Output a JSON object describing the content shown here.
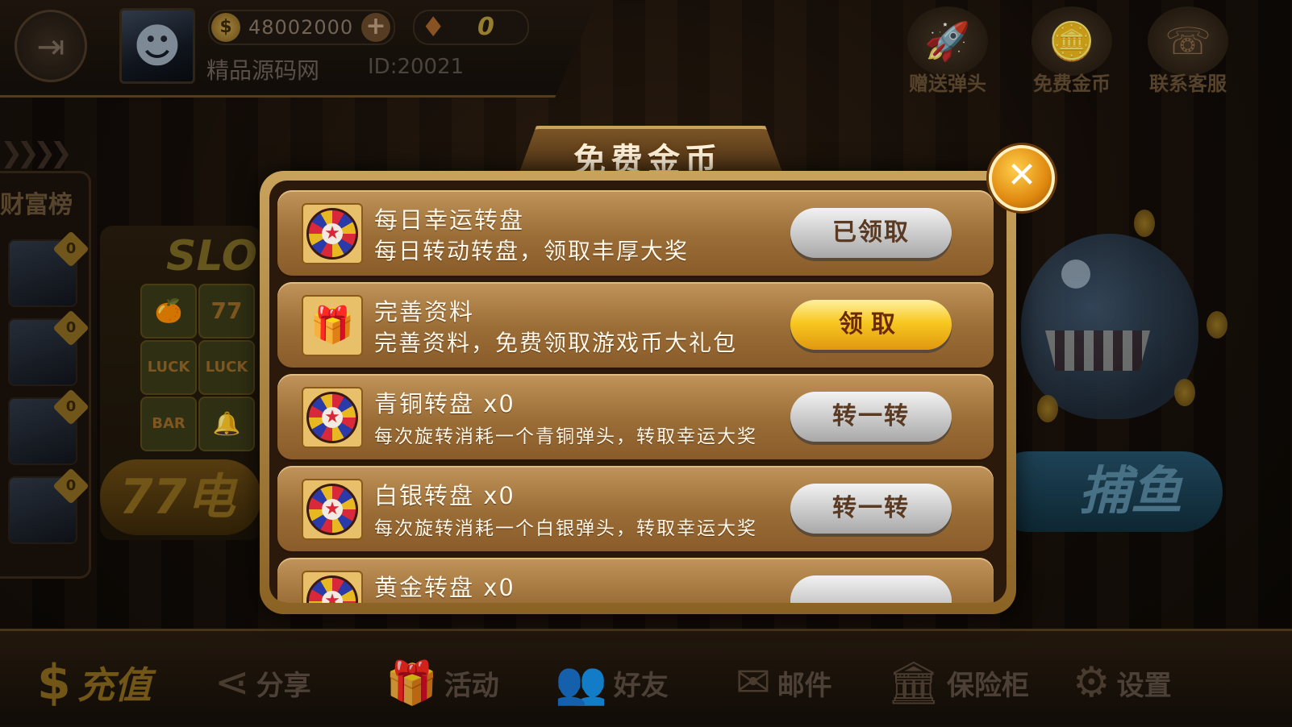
{
  "header": {
    "coins": "48002000",
    "gems": "0",
    "nickname": "精品源码网",
    "user_id": "ID:20021",
    "exit_icon": "exit-door-icon",
    "plus_icon": "plus-icon"
  },
  "top_actions": [
    {
      "label": "赠送弹头",
      "icon": "missile-icon",
      "glyph": "🚀"
    },
    {
      "label": "免费金币",
      "icon": "gold-coins-icon",
      "glyph": "🪙"
    },
    {
      "label": "联系客服",
      "icon": "phone-icon",
      "glyph": "☏"
    }
  ],
  "rank": {
    "title": "财富榜",
    "badge": "0"
  },
  "games": {
    "slot_title": "SLO",
    "slot_name": "77电",
    "slot_cells": [
      "🍊",
      "77",
      "LUCK",
      "LUCK",
      "BAR",
      "🔔"
    ],
    "fish_name": "捕鱼"
  },
  "bottom_nav": [
    {
      "label": "充值",
      "icon": "money-bag-icon",
      "glyph": "$"
    },
    {
      "label": "分享",
      "icon": "share-icon",
      "glyph": "⋖"
    },
    {
      "label": "活动",
      "icon": "gift-icon",
      "glyph": "🎁"
    },
    {
      "label": "好友",
      "icon": "friends-icon",
      "glyph": "👥"
    },
    {
      "label": "邮件",
      "icon": "mailbox-icon",
      "glyph": "✉"
    },
    {
      "label": "保险柜",
      "icon": "bank-icon",
      "glyph": "🏛"
    },
    {
      "label": "设置",
      "icon": "gear-icon",
      "glyph": "⚙"
    }
  ],
  "dialog": {
    "title": "免费金币",
    "close_icon": "close-icon",
    "rows": [
      {
        "title": "每日幸运转盘",
        "desc": "每日转动转盘，领取丰厚大奖",
        "button": "已领取",
        "button_style": "gray",
        "icon": "wheel-icon"
      },
      {
        "title": "完善资料",
        "desc": "完善资料，免费领取游戏币大礼包",
        "button": "领取",
        "button_style": "gold",
        "icon": "gift-box-icon"
      },
      {
        "title": "青铜转盘  x0",
        "desc": "每次旋转消耗一个青铜弹头，转取幸运大奖",
        "button": "转一转",
        "button_style": "gray",
        "icon": "wheel-icon"
      },
      {
        "title": "白银转盘  x0",
        "desc": "每次旋转消耗一个白银弹头，转取幸运大奖",
        "button": "转一转",
        "button_style": "gray",
        "icon": "wheel-icon"
      },
      {
        "title": "黄金转盘  x0",
        "desc": "",
        "button": "",
        "button_style": "gray",
        "icon": "wheel-icon"
      }
    ]
  }
}
